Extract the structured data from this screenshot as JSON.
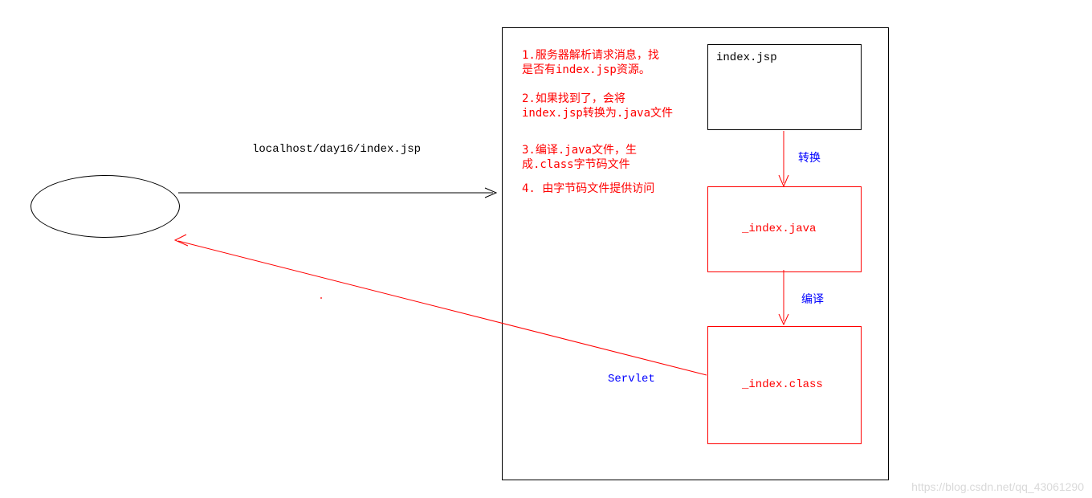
{
  "request_url": "localhost/day16/index.jsp",
  "steps": {
    "s1": "1.服务器解析请求消息，找\n是否有index.jsp资源。",
    "s2": "2.如果找到了，会将\nindex.jsp转换为.java文件",
    "s3": "3.编译.java文件，生\n成.class字节码文件",
    "s4": "4. 由字节码文件提供访问"
  },
  "boxes": {
    "jsp": "index.jsp",
    "java": "_index.java",
    "class_": "_index.class"
  },
  "arrows": {
    "convert": "转换",
    "compile": "编译"
  },
  "servlet_label": "Servlet",
  "watermark": "https://blog.csdn.net/qq_43061290"
}
